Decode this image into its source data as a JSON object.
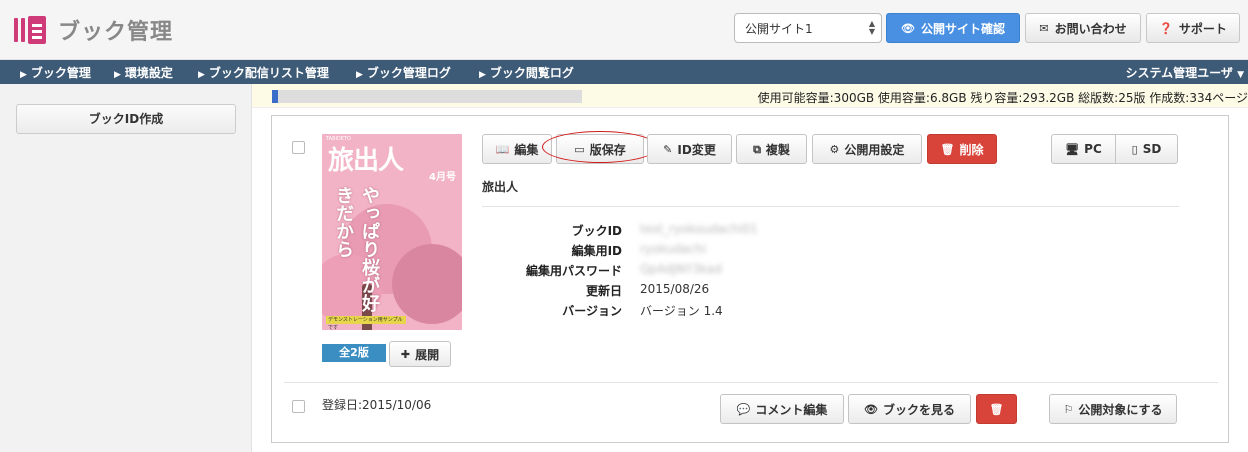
{
  "app": {
    "title": "ブック管理"
  },
  "header": {
    "site_select": {
      "value": "公開サイト1"
    },
    "buttons": {
      "preview": "公開サイト確認",
      "contact": "お問い合わせ",
      "support": "サポート"
    }
  },
  "nav": {
    "items": [
      "ブック管理",
      "環境設定",
      "ブック配信リスト管理",
      "ブック管理ログ",
      "ブック閲覧ログ"
    ],
    "user_menu": "システム管理ユーザ"
  },
  "sidebar": {
    "create_button": "ブックID作成"
  },
  "capacity": {
    "used_fraction": 0.019,
    "text": "使用可能容量:300GB 使用容量:6.8GB 残り容量:293.2GB 総版数:25版 作成数:334ページ"
  },
  "book": {
    "cover": {
      "title": "旅出人",
      "month": "4月号",
      "headline": "やっぱり桜が好きだから",
      "tag": "デモンストレーション用サンプルです"
    },
    "toolbar": {
      "edit": "編集",
      "save_version": "版保存",
      "change_id": "ID変更",
      "duplicate": "複製",
      "publish_settings": "公開用設定",
      "delete": "削除",
      "pc": "PC",
      "sd": "SD"
    },
    "title": "旅出人",
    "info": {
      "labels": {
        "book_id": "ブックID",
        "edit_id": "編集用ID",
        "edit_password": "編集用パスワード",
        "updated": "更新日",
        "version": "バージョン"
      },
      "values": {
        "book_id": "test_ryokoudachi01",
        "edit_id": "ryokudachi",
        "edit_password": "QpAdJNY3kad",
        "updated": "2015/08/26",
        "version": "バージョン 1.4"
      }
    },
    "version_badge": "全2版",
    "expand_button": "展開",
    "registered": "登録日:2015/10/06",
    "footer_buttons": {
      "comment_edit": "コメント編集",
      "view_book": "ブックを見る",
      "make_public": "公開対象にする"
    }
  },
  "colors": {
    "accent": "#4a90e2",
    "nav": "#3d5a77",
    "danger": "#d9443a",
    "badge": "#3b8ec2",
    "logo": "#cf3a78"
  }
}
